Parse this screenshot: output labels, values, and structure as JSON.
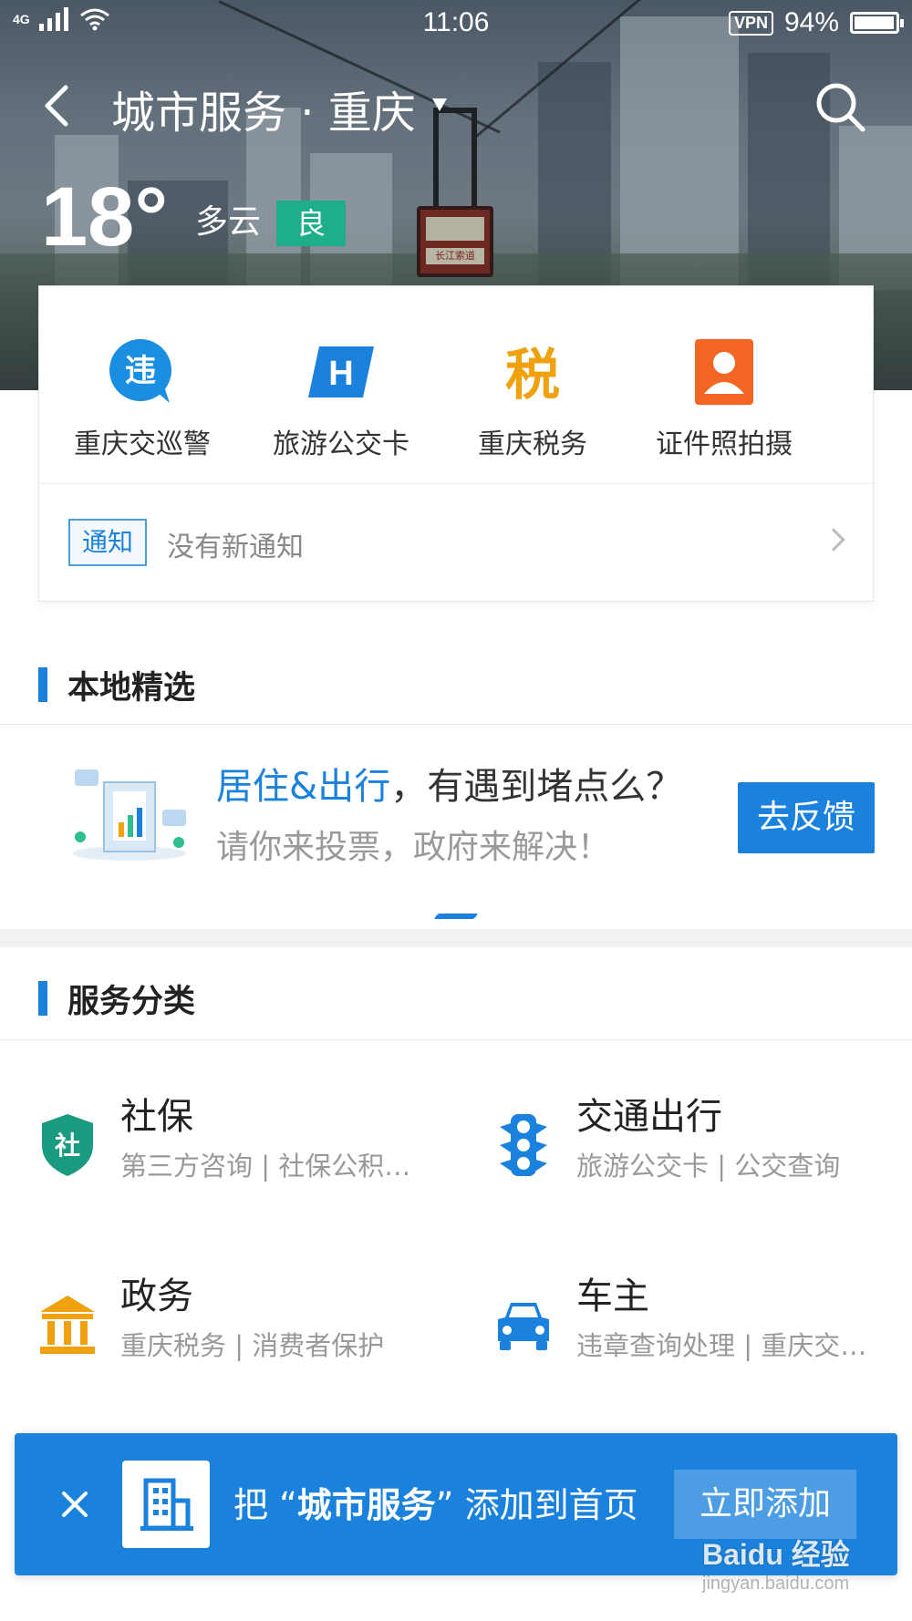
{
  "status_bar": {
    "network": "4G",
    "time": "11:06",
    "vpn": "VPN",
    "battery": "94%",
    "battery_level": 0.94
  },
  "nav": {
    "title": "城市服务 · 重庆"
  },
  "weather": {
    "temperature": "18°",
    "condition": "多云",
    "air_quality": "良"
  },
  "quick_apps": [
    {
      "label": "重庆交巡警",
      "icon": "violation-icon",
      "color": "#1a8ee0",
      "glyph": "违"
    },
    {
      "label": "旅游公交卡",
      "icon": "bus-card-icon",
      "color": "#1a82dc",
      "glyph": "H"
    },
    {
      "label": "重庆税务",
      "icon": "tax-icon",
      "color": "#f0a10f",
      "glyph": "税"
    },
    {
      "label": "证件照拍摄",
      "icon": "id-photo-icon",
      "color": "#f26522"
    }
  ],
  "notice": {
    "tag": "通知",
    "text": "没有新通知"
  },
  "local_picks": {
    "title": "本地精选",
    "banner": {
      "headline_highlight": "居住&出行",
      "headline_rest": "，有遇到堵点么？",
      "subline": "请你来投票，政府来解决！",
      "button": "去反馈"
    }
  },
  "service_categories": {
    "title": "服务分类",
    "items": [
      {
        "title": "社保",
        "subtitle": "第三方咨询 | 社保公积…",
        "icon": "social-security-shield-icon",
        "color": "#1a9a7f",
        "glyph": "社"
      },
      {
        "title": "交通出行",
        "subtitle": "旅游公交卡 | 公交查询",
        "icon": "traffic-light-icon",
        "color": "#1a82dc"
      },
      {
        "title": "政务",
        "subtitle": "重庆税务 | 消费者保护",
        "icon": "government-building-icon",
        "color": "#f0a10f"
      },
      {
        "title": "车主",
        "subtitle": "违章查询处理 | 重庆交…",
        "icon": "car-icon",
        "color": "#1a82dc"
      }
    ]
  },
  "add_bar": {
    "prefix": "把 “",
    "app_name": "城市服务",
    "suffix": "” 添加到首页",
    "button": "立即添加"
  },
  "watermark": {
    "brand": "Baidu 经验",
    "url": "jingyan.baidu.com"
  },
  "colors": {
    "accent": "#1a82dc",
    "aqi_good": "#1fae8a"
  }
}
